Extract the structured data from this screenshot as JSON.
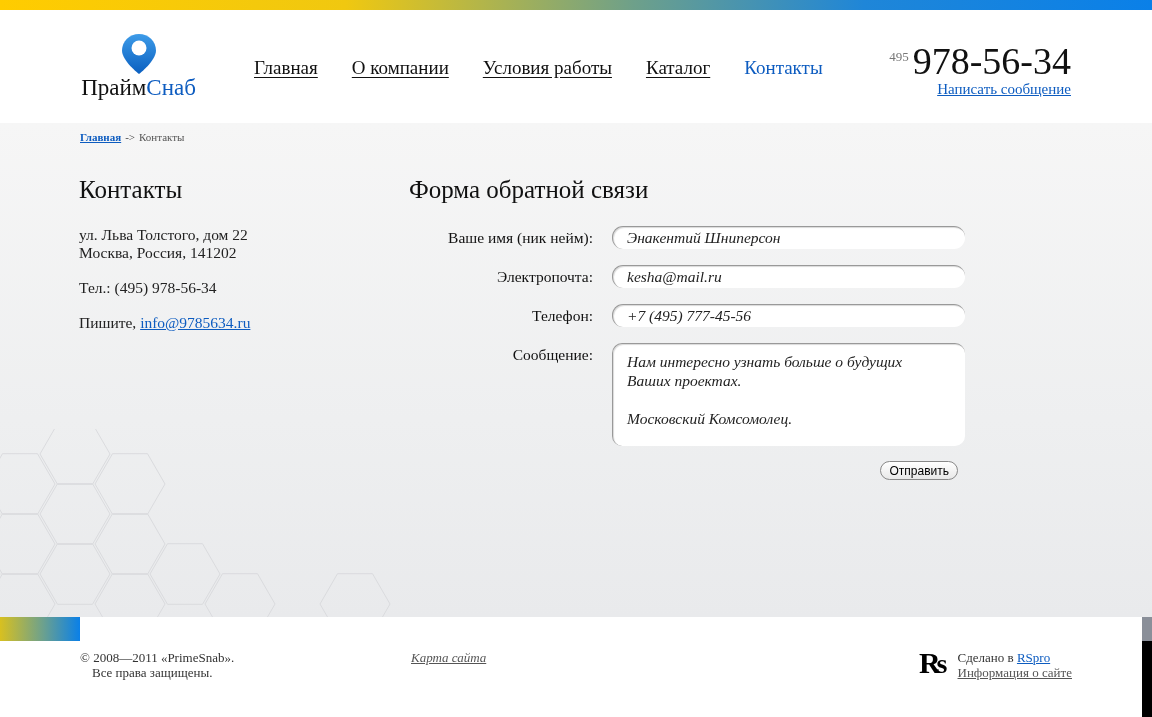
{
  "header": {
    "logo": {
      "dark_part": "Прайм",
      "accent_part": "Снаб"
    },
    "nav": [
      {
        "label": "Главная",
        "selected": false
      },
      {
        "label": "О компании",
        "selected": false
      },
      {
        "label": "Условия работы",
        "selected": false
      },
      {
        "label": "Каталог",
        "selected": false
      },
      {
        "label": "Контакты",
        "selected": true
      }
    ],
    "phone": {
      "code": "495",
      "number": "978-56-34",
      "link": "Написать сообщение"
    }
  },
  "breadcrumb": [
    {
      "label": "Главная",
      "kind": "link"
    },
    {
      "label": "->",
      "kind": "separator"
    },
    {
      "label": "Контакты",
      "kind": "current"
    }
  ],
  "contacts": {
    "title": "Контакты",
    "address_lines": [
      "ул. Льва Толстого, дом 22",
      "Москва, Россия, 141202"
    ],
    "phone_line": "Тел.: (495) 978-56-34",
    "write_text": "Пишите,",
    "email_link": "info@9785634.ru"
  },
  "form": {
    "title": "Форма обратной связи",
    "fields": [
      {
        "label": "Ваше имя (ник нейм):",
        "value": "Энакентий Шниперсон",
        "kind": "input"
      },
      {
        "label": "Электропочта:",
        "value": "kesha@mail.ru",
        "kind": "input"
      },
      {
        "label": "Телефон:",
        "value": "+7 (495) 777-45-56",
        "kind": "input"
      },
      {
        "label": "Сообщение:",
        "value": "Нам интересно узнать больше о будущих Ваших проектах.\n\nМосковский Комсомолец.",
        "kind": "textarea"
      }
    ],
    "submit": "Отправить"
  },
  "footer": {
    "copyright_lines": [
      "© 2008—2011 «PrimeSnab».",
      "Все права защищены."
    ],
    "sitemap_link": "Карта сайта",
    "studio_logo": "Rs",
    "made_by_text": "Сделано в",
    "made_by_link": "RSpro",
    "info_link": "Информация о сайте"
  }
}
